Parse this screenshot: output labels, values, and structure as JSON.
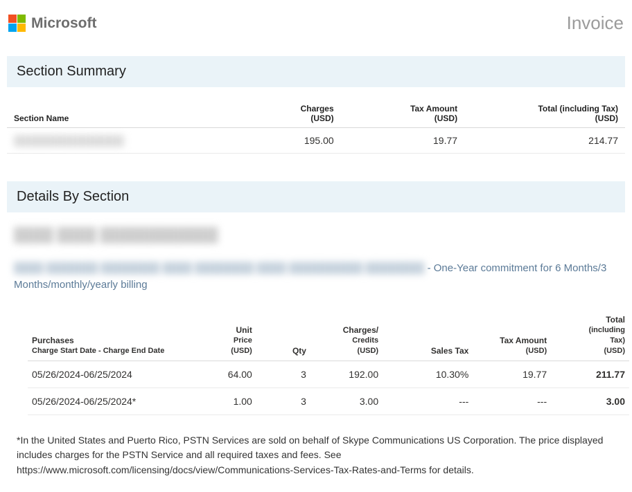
{
  "header": {
    "brand": "Microsoft",
    "title": "Invoice"
  },
  "section_summary": {
    "heading": "Section Summary",
    "columns": {
      "name": "Section Name",
      "charges_l1": "Charges",
      "charges_l2": "(USD)",
      "tax_l1": "Tax Amount",
      "tax_l2": "(USD)",
      "total_l1": "Total (including Tax)",
      "total_l2": "(USD)"
    },
    "rows": [
      {
        "name": "████████████████",
        "charges": "195.00",
        "tax": "19.77",
        "total": "214.77"
      }
    ]
  },
  "details": {
    "heading": "Details By Section",
    "sub_redacted": "████ ████ ████████████",
    "item_redacted_prefix": "████  ███████ ████████   ████  ████████ ████ ██████████ ████████",
    "item_desc_suffix": " - One-Year commitment for 6 Months/3 Months/monthly/yearly billing",
    "columns": {
      "purchases_l1": "Purchases",
      "purchases_l2": "Charge Start Date - Charge End Date",
      "unit_l1": "Unit",
      "unit_l2": "Price",
      "unit_l3": "(USD)",
      "qty": "Qty",
      "charges_l1": "Charges/",
      "charges_l2": "Credits",
      "charges_l3": "(USD)",
      "sales_tax": "Sales Tax",
      "tax_l1": "Tax Amount",
      "tax_l2": "(USD)",
      "total_l1": "Total",
      "total_l2": "(including",
      "total_l3": "Tax)",
      "total_l4": "(USD)"
    },
    "rows": [
      {
        "period": "05/26/2024-06/25/2024",
        "unit_price": "64.00",
        "qty": "3",
        "charges": "192.00",
        "sales_tax": "10.30%",
        "tax_amount": "19.77",
        "total": "211.77"
      },
      {
        "period": "05/26/2024-06/25/2024*",
        "unit_price": "1.00",
        "qty": "3",
        "charges": "3.00",
        "sales_tax": "---",
        "tax_amount": "---",
        "total": "3.00"
      }
    ]
  },
  "footnote": "*In the United States and Puerto Rico, PSTN Services are sold on behalf of Skype Communications US Corporation. The price displayed includes charges for the PSTN Service and all required taxes and fees. See https://www.microsoft.com/licensing/docs/view/Communications-Services-Tax-Rates-and-Terms for details."
}
